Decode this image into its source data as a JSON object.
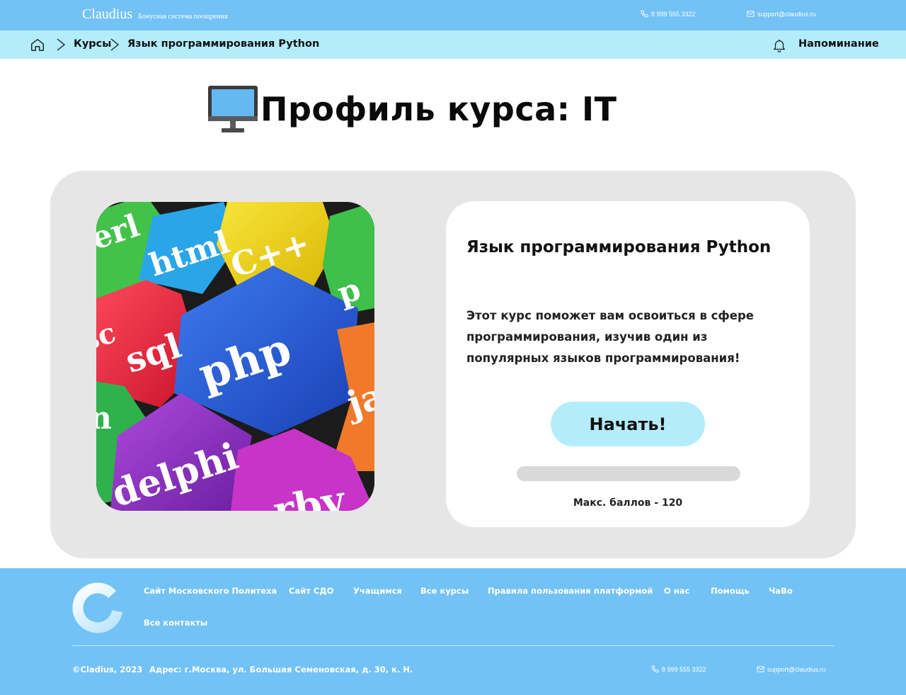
{
  "header": {
    "brand_name": "Claudius",
    "brand_tagline": "Бонусная система поощрения",
    "phone": "8 999 555 3322",
    "email": "support@claudius.ru"
  },
  "breadcrumb": {
    "items": [
      "Курсы",
      "Язык программирования Python"
    ],
    "reminder_label": "Напоминание"
  },
  "page": {
    "title": "Профиль курса: IT"
  },
  "course": {
    "image_words": [
      "perl",
      "html",
      "C++",
      "sql",
      "php",
      "delphi",
      "java",
      "ruby"
    ],
    "title": "Язык программирования Python",
    "description": "Этот курс поможет вам освоиться в сфере программирования, изучив один из популярных языков программирования!",
    "start_label": "Начать!",
    "progress": 0,
    "max_points_text": "Макс. баллов - 120"
  },
  "footer": {
    "links": [
      "Сайт Московского Политеха",
      "Сайт СДО",
      "Учащимся",
      "Все курсы",
      "Правила пользования платформой",
      "О нас",
      "Помощь",
      "ЧаВо",
      "Все контакты"
    ],
    "copyright": "©Cladius, 2023",
    "address": "Адрес: г.Москва, ул. Большая Семеновская, д. 30, к. Н.",
    "phone": "8 999 555 3322",
    "email": "support@claudius.ru"
  },
  "colors": {
    "header_bg": "#72c2f6",
    "breadcrumb_bg": "#b3ecfb",
    "panel_bg": "#e6e6e6",
    "button_bg": "#b3ecfb"
  }
}
